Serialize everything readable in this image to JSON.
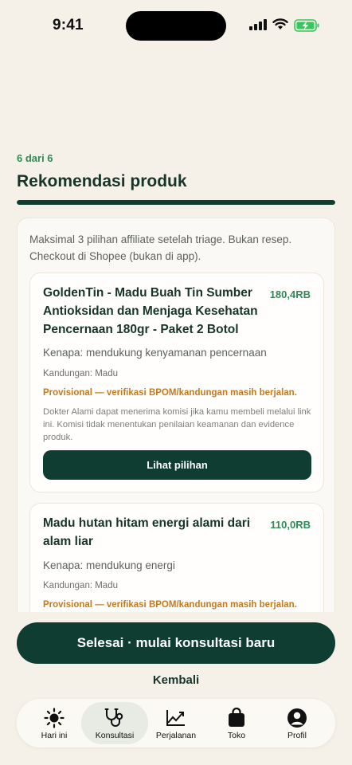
{
  "status": {
    "time": "9:41"
  },
  "step": "6 dari 6",
  "title": "Rekomendasi produk",
  "progress": 1.0,
  "note": "Maksimal 3 pilihan affiliate setelah triage. Bukan resep. Checkout di Shopee (bukan di app).",
  "products": [
    {
      "title": "GoldenTin - Madu Buah Tin Sumber Antioksidan dan Menjaga Kesehatan Pencernaan 180gr - Paket 2 Botol",
      "price": "180,4RB",
      "reason": "Kenapa: mendukung kenyamanan pencernaan",
      "ingredients": "Kandungan: Madu",
      "warning": "Provisional — verifikasi BPOM/kandungan masih berjalan.",
      "disclaimer": "Dokter Alami dapat menerima komisi jika kamu membeli melalui link ini. Komisi tidak menentukan penilaian keamanan dan evidence produk.",
      "button": "Lihat pilihan"
    },
    {
      "title": "Madu hutan hitam energi alami dari alam liar",
      "price": "110,0RB",
      "reason": "Kenapa: mendukung energi",
      "ingredients": "Kandungan: Madu",
      "warning": "Provisional — verifikasi BPOM/kandungan masih berjalan."
    }
  ],
  "primary_button": "Selesai · mulai konsultasi baru",
  "back_link": "Kembali",
  "tabs": [
    {
      "label": "Hari ini",
      "icon": "sun-icon"
    },
    {
      "label": "Konsultasi",
      "icon": "stethoscope-icon",
      "active": true
    },
    {
      "label": "Perjalanan",
      "icon": "chart-line-icon"
    },
    {
      "label": "Toko",
      "icon": "shopping-bag-icon"
    },
    {
      "label": "Profil",
      "icon": "profile-icon"
    }
  ],
  "colors": {
    "accent": "#0f3d32",
    "price": "#2f8a55",
    "warning": "#c47a1c",
    "background": "#f6f1e8",
    "battery": "#34c759"
  }
}
